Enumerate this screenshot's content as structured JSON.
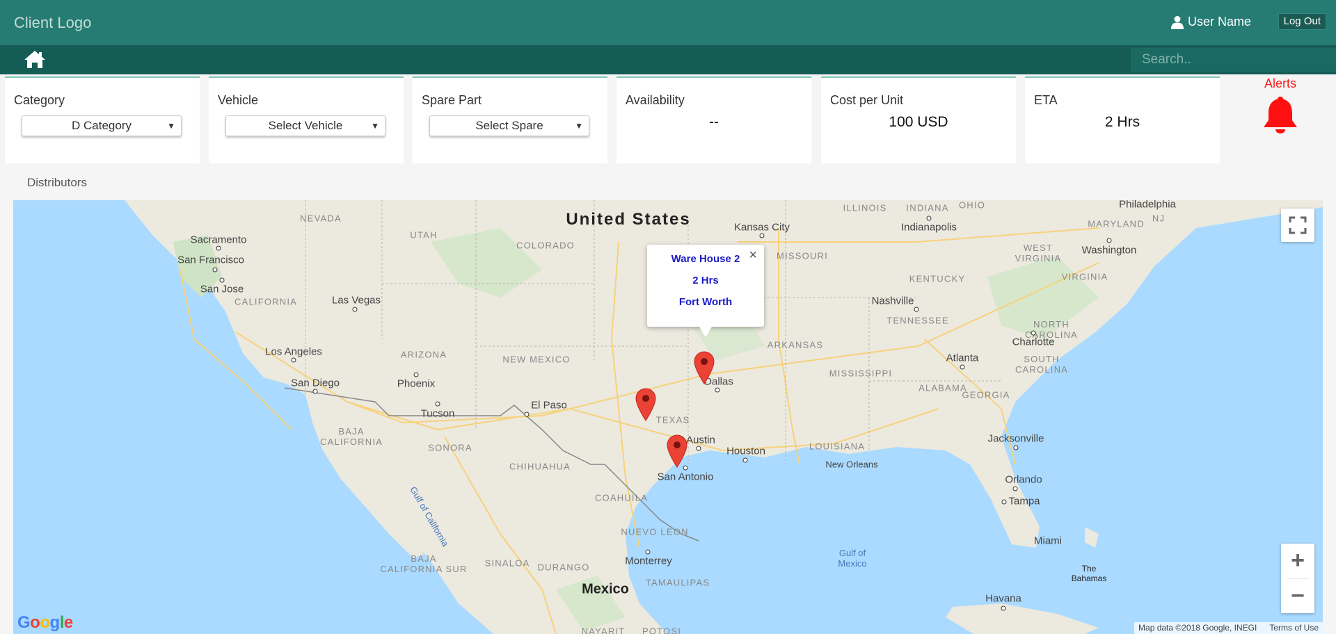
{
  "header": {
    "logo": "Client Logo",
    "user_name": "User Name",
    "logout_label": "Log Out"
  },
  "nav": {
    "search_placeholder": "Search.."
  },
  "filters": {
    "category": {
      "label": "Category",
      "value": "D Category"
    },
    "vehicle": {
      "label": "Vehicle",
      "value": "Select Vehicle"
    },
    "spare_part": {
      "label": "Spare Part",
      "value": "Select Spare"
    },
    "availability": {
      "label": "Availability",
      "value": "--"
    },
    "cost": {
      "label": "Cost per Unit",
      "value": "100 USD"
    },
    "eta": {
      "label": "ETA",
      "value": "2 Hrs"
    }
  },
  "alerts": {
    "label": "Alerts"
  },
  "section_title": "Distributors",
  "map": {
    "popup": {
      "name": "Ware House 2",
      "eta": "2 Hrs",
      "city": "Fort Worth"
    },
    "labels": {
      "country_us": "United States",
      "country_mx": "Mexico",
      "nevada": "NEVADA",
      "utah": "UTAH",
      "colorado": "COLORADO",
      "arizona": "ARIZONA",
      "new_mexico": "NEW MEXICO",
      "california": "CALIFORNIA",
      "texas": "TEXAS",
      "missouri": "MISSOURI",
      "arkansas": "ARKANSAS",
      "mississippi": "MISSISSIPPI",
      "alabama": "ALABAMA",
      "georgia": "GEORGIA",
      "louisiana": "LOUISIANA",
      "tennessee": "TENNESSEE",
      "kentucky": "KENTUCKY",
      "illinois": "ILLINOIS",
      "indiana": "INDIANA",
      "ohio": "OHIO",
      "west_virginia": "WEST\nVIRGINIA",
      "virginia": "VIRGINIA",
      "maryland": "MARYLAND",
      "nj": "NJ",
      "north_carolina": "NORTH\nCAROLINA",
      "south_carolina": "SOUTH\nCAROLINA",
      "baja_california": "BAJA\nCALIFORNIA",
      "sonora": "SONORA",
      "chihuahua": "CHIHUAHUA",
      "coahuila": "COAHUILA",
      "nuevo_leon": "NUEVO LEON",
      "sinaloa": "SINALOA",
      "durango": "DURANGO",
      "tamaulipas": "TAMAULIPAS",
      "baja_california_sur": "BAJA\nCALIFORNIA SUR",
      "nayarit": "NAYARIT",
      "potosi": "POTOSI",
      "sacramento": "Sacramento",
      "san_francisco": "San Francisco",
      "san_jose": "San Jose",
      "las_vegas": "Las Vegas",
      "los_angeles": "Los Angeles",
      "san_diego": "San Diego",
      "phoenix": "Phoenix",
      "tucson": "Tucson",
      "el_paso": "El Paso",
      "dallas": "Dallas",
      "austin": "Austin",
      "houston": "Houston",
      "san_antonio": "San Antonio",
      "kansas_city": "Kansas City",
      "indianapolis": "Indianapolis",
      "philadelphia": "Philadelphia",
      "washington": "Washington",
      "nashville": "Nashville",
      "charlotte": "Charlotte",
      "atlanta": "Atlanta",
      "jacksonville": "Jacksonville",
      "new_orleans": "New Orleans",
      "orlando": "Orlando",
      "tampa": "Tampa",
      "miami": "Miami",
      "monterrey": "Monterrey",
      "havana": "Havana",
      "the_bahamas": "The\nBahamas",
      "gulf_of_mexico": "Gulf of\nMexico",
      "gulf_of_california": "Gulf of California"
    },
    "attribution": "Map data ©2018 Google, INEGI",
    "terms": "Terms of Use",
    "google": "Google"
  }
}
